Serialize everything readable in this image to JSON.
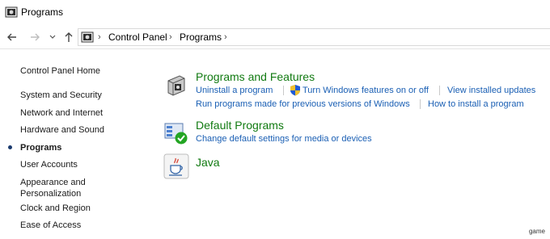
{
  "window": {
    "title": "Programs",
    "icon": "control-panel-icon"
  },
  "nav": {
    "back_icon": "arrow-left-icon",
    "forward_icon": "arrow-right-icon",
    "recent_icon": "chevron-down-icon",
    "up_icon": "arrow-up-icon",
    "breadcrumb": [
      "Control Panel",
      "Programs"
    ],
    "separator": "›"
  },
  "sidebar": {
    "items": [
      {
        "label": "Control Panel Home"
      },
      {
        "label": "System and Security"
      },
      {
        "label": "Network and Internet"
      },
      {
        "label": "Hardware and Sound"
      },
      {
        "label": "Programs",
        "current": true
      },
      {
        "label": "User Accounts"
      },
      {
        "label": "Appearance and Personalization",
        "line1": "Appearance and",
        "line2": "Personalization"
      },
      {
        "label": "Clock and Region"
      },
      {
        "label": "Ease of Access"
      }
    ]
  },
  "categories": {
    "programs_features": {
      "title": "Programs and Features",
      "icon": "programs-box-icon",
      "links": [
        "Uninstall a program",
        "Turn Windows features on or off",
        "View installed updates",
        "Run programs made for previous versions of Windows",
        "How to install a program"
      ]
    },
    "default_programs": {
      "title": "Default Programs",
      "icon": "default-programs-icon",
      "links": [
        "Change default settings for media or devices"
      ]
    },
    "java": {
      "title": "Java",
      "icon": "java-cup-icon",
      "links": []
    }
  },
  "colors": {
    "category_title": "#117a11",
    "link": "#1a5fb4"
  },
  "watermark": "game"
}
